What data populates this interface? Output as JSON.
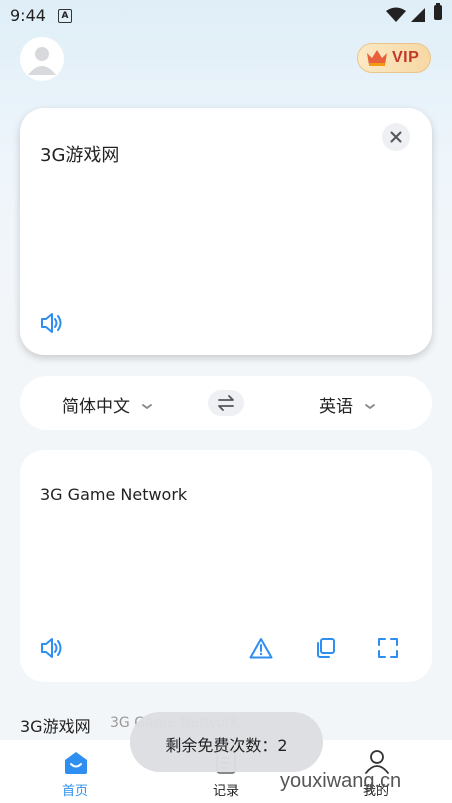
{
  "status_bar": {
    "time": "9:44",
    "notification_glyph": "A"
  },
  "header": {
    "vip_label": "VIP"
  },
  "input": {
    "text": "3G游戏网"
  },
  "languages": {
    "source": "简体中文",
    "target": "英语"
  },
  "output": {
    "text": "3G Game Network"
  },
  "history": {
    "source": "3G游戏网",
    "target": "3G Game Network"
  },
  "toast": {
    "text": "剩余免费次数：2"
  },
  "bottom_nav": [
    {
      "label": "首页",
      "active": true
    },
    {
      "label": "记录",
      "active": false
    },
    {
      "label": "我的",
      "active": false
    }
  ],
  "watermark": "youxiwang.cn",
  "colors": {
    "accent": "#2f8ff0",
    "vip_text": "#c0392b"
  }
}
